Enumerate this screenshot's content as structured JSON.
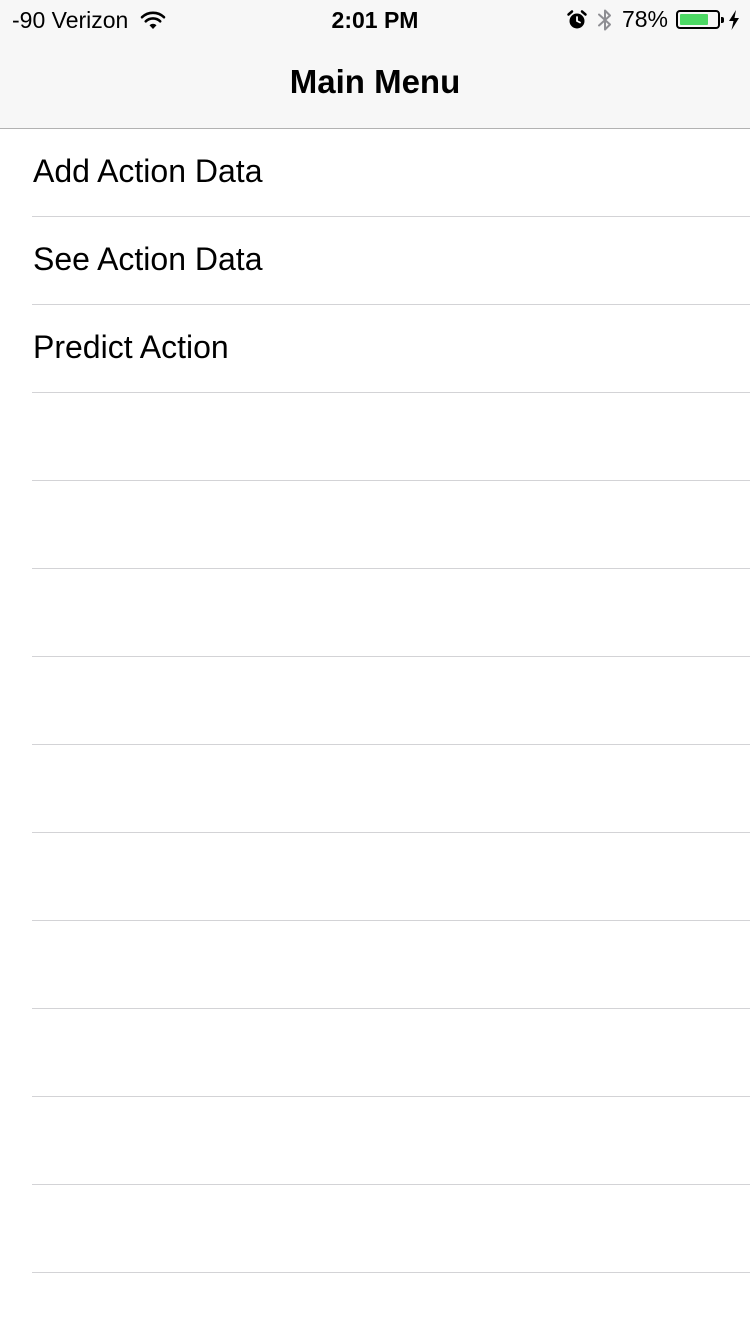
{
  "status_bar": {
    "carrier": "-90 Verizon",
    "time": "2:01 PM",
    "battery_percent": "78%",
    "battery_level": 0.78,
    "icons": [
      "wifi-icon",
      "alarm-icon",
      "bluetooth-icon",
      "battery-icon",
      "charging-icon"
    ]
  },
  "nav": {
    "title": "Main Menu"
  },
  "menu": {
    "items": [
      {
        "label": "Add Action Data"
      },
      {
        "label": "See Action Data"
      },
      {
        "label": "Predict Action"
      }
    ],
    "empty_rows": 10
  },
  "colors": {
    "battery_fill": "#4cd964",
    "bar_background": "#f7f7f7",
    "separator": "#d3d3d6"
  }
}
